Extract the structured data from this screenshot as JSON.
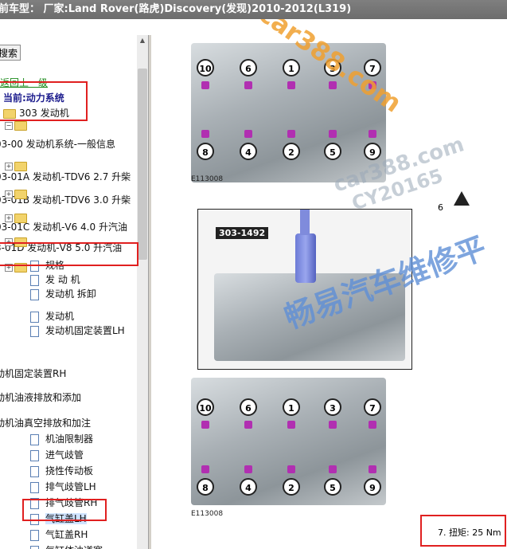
{
  "title": "前车型： 厂家:Land Rover(路虎)Discovery(发现)2010-2012(L319)",
  "search_label": "搜索",
  "tree": [
    {
      "text": "返回上一级",
      "style": "green"
    },
    {
      "text": "当前:动力系统",
      "style": "blue"
    },
    {
      "text": "303 发动机",
      "style": "folder"
    },
    {
      "text": "03-00 发动机系统-一般信息",
      "style": "plain"
    },
    {
      "text": "03-01A 发动机-TDV6 2.7 升柴",
      "style": "plain"
    },
    {
      "text": "03-01B 发动机-TDV6 3.0 升柴",
      "style": "plain"
    },
    {
      "text": "03-01C 发动机-V6 4.0 升汽油",
      "style": "plain"
    },
    {
      "text": "3-01D 发动机-V8 5.0 升汽油",
      "style": "plain"
    },
    {
      "text": "规格",
      "style": "doc"
    },
    {
      "text": "发 动 机",
      "style": "doc"
    },
    {
      "text": "发动机 拆卸",
      "style": "doc"
    },
    {
      "text": "发动机",
      "style": "doc"
    },
    {
      "text": "发动机固定装置LH",
      "style": "doc"
    },
    {
      "text": "动机固定装置RH",
      "style": "plain"
    },
    {
      "text": "动机油液排放和添加",
      "style": "plain"
    },
    {
      "text": "动机油真空排放和加注",
      "style": "plain"
    },
    {
      "text": "机油限制器",
      "style": "doc"
    },
    {
      "text": "进气歧管",
      "style": "doc"
    },
    {
      "text": "挠性传动板",
      "style": "doc"
    },
    {
      "text": "排气歧管LH",
      "style": "doc"
    },
    {
      "text": "排气歧管RH",
      "style": "doc"
    },
    {
      "text": "气缸盖LH",
      "style": "doc-selected"
    },
    {
      "text": "气缸盖RH",
      "style": "doc"
    },
    {
      "text": "气缸体油道塞",
      "style": "doc"
    }
  ],
  "figures": {
    "top_callouts_upper": [
      "10",
      "6",
      "1",
      "3",
      "7"
    ],
    "top_callouts_lower": [
      "8",
      "4",
      "2",
      "5",
      "9"
    ],
    "bottom_callouts_upper": [
      "10",
      "6",
      "1",
      "3",
      "7"
    ],
    "bottom_callouts_lower": [
      "8",
      "4",
      "2",
      "5",
      "9"
    ],
    "caption_top": "E113008",
    "caption_bottom": "E113008",
    "tool_label": "303-1492",
    "step_number": "6"
  },
  "watermarks": {
    "site": "car388.com",
    "site2": "car388.com",
    "code": "CY20165",
    "chinese": "畅易汽车维修平"
  },
  "torque": {
    "text": "7. 扭矩: 25 Nm"
  },
  "colors": {
    "highlight": "#e02020",
    "pin": "#b12fb1",
    "title_bg": "#767676"
  }
}
